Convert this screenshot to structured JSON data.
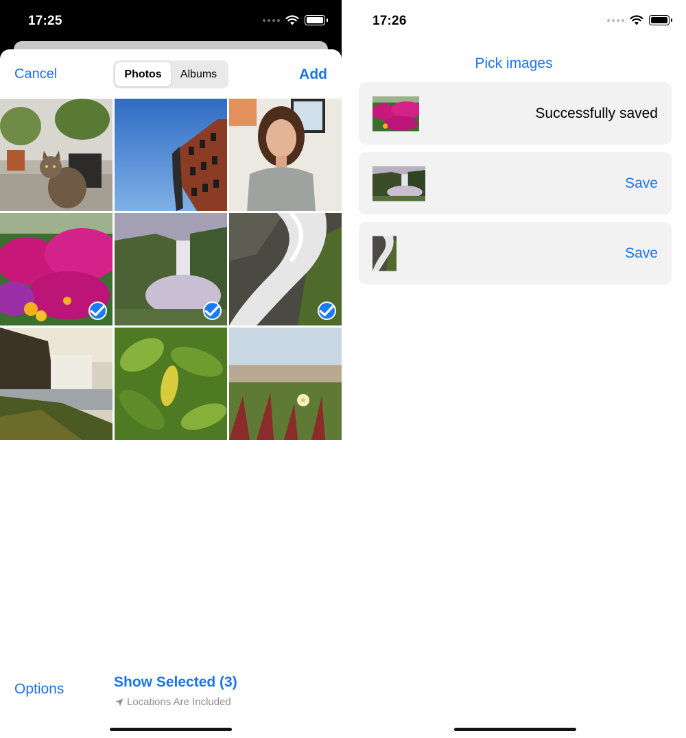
{
  "left_screen": {
    "status_time": "17:25",
    "nav": {
      "cancel_label": "Cancel",
      "add_label": "Add"
    },
    "segments": [
      {
        "label": "Photos",
        "active": true
      },
      {
        "label": "Albums",
        "active": false
      }
    ],
    "photos": [
      {
        "subject": "cat",
        "selected": false
      },
      {
        "subject": "building",
        "selected": false
      },
      {
        "subject": "woman",
        "selected": false
      },
      {
        "subject": "flowers",
        "selected": true
      },
      {
        "subject": "waterfall-valley",
        "selected": true
      },
      {
        "subject": "waterfall-closeup",
        "selected": true
      },
      {
        "subject": "waterfall-cliff",
        "selected": false
      },
      {
        "subject": "leaves",
        "selected": false
      },
      {
        "subject": "beach-plants",
        "selected": false
      }
    ],
    "footer": {
      "options_label": "Options",
      "show_selected_label": "Show Selected (3)",
      "location_note": "Locations Are Included"
    }
  },
  "right_screen": {
    "status_time": "17:26",
    "pick_images_label": "Pick images",
    "rows": [
      {
        "thumb_subject": "flowers",
        "status_text": "Successfully saved",
        "action_label": ""
      },
      {
        "thumb_subject": "waterfall-valley",
        "status_text": "",
        "action_label": "Save"
      },
      {
        "thumb_subject": "waterfall-closeup",
        "status_text": "",
        "action_label": "Save"
      }
    ]
  },
  "colors": {
    "accent": "#1a73e8",
    "selection_check": "#1a7cf5",
    "card_bg": "#f2f2f2"
  },
  "icons": [
    "wifi-icon",
    "battery-icon",
    "signal-dots-icon",
    "checkmark-icon",
    "location-arrow-icon"
  ]
}
